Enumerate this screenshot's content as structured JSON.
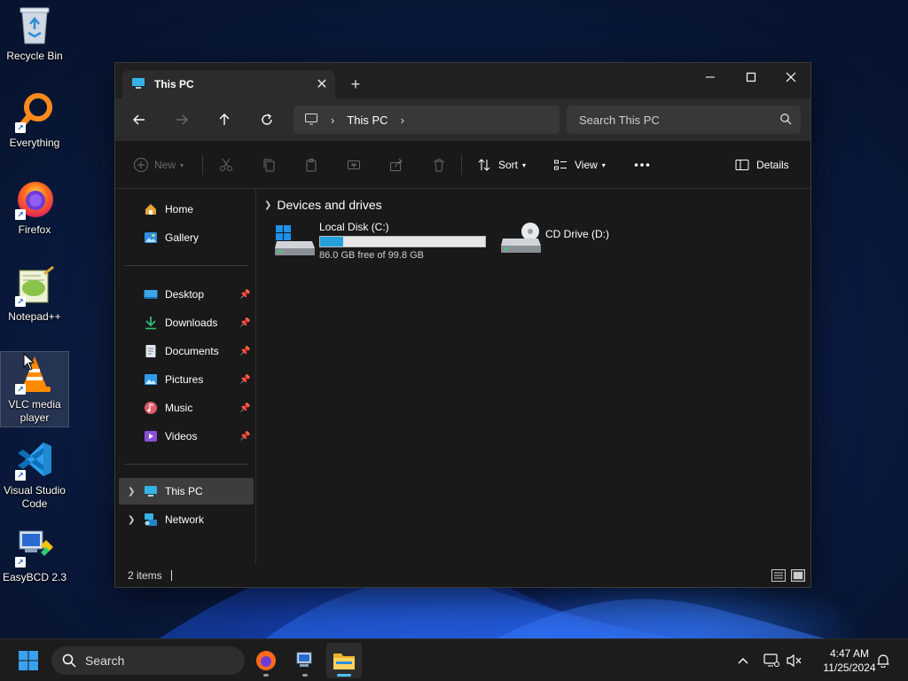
{
  "desktop": {
    "icons": [
      {
        "label": "Recycle Bin",
        "icon": "recycle-bin-icon"
      },
      {
        "label": "Everything",
        "icon": "everything-icon"
      },
      {
        "label": "Firefox",
        "icon": "firefox-icon"
      },
      {
        "label": "Notepad++",
        "icon": "notepad-plus-plus-icon"
      },
      {
        "label": "VLC media player",
        "icon": "vlc-icon"
      },
      {
        "label": "Visual Studio Code",
        "icon": "vscode-icon"
      },
      {
        "label": "EasyBCD 2.3",
        "icon": "easybcd-icon"
      }
    ]
  },
  "window": {
    "tab_title": "This PC",
    "address": {
      "crumb": "This PC"
    },
    "search": {
      "placeholder": "Search This PC"
    },
    "toolbar": {
      "new_label": "New",
      "sort_label": "Sort",
      "view_label": "View",
      "details_label": "Details"
    },
    "sidebar": {
      "items": [
        {
          "label": "Home",
          "icon": "home-icon",
          "pinned": false
        },
        {
          "label": "Gallery",
          "icon": "gallery-icon",
          "pinned": false
        },
        {
          "label": "Desktop",
          "icon": "desktop-folder-icon",
          "pinned": true
        },
        {
          "label": "Downloads",
          "icon": "downloads-icon",
          "pinned": true
        },
        {
          "label": "Documents",
          "icon": "documents-icon",
          "pinned": true
        },
        {
          "label": "Pictures",
          "icon": "pictures-icon",
          "pinned": true
        },
        {
          "label": "Music",
          "icon": "music-icon",
          "pinned": true
        },
        {
          "label": "Videos",
          "icon": "videos-icon",
          "pinned": true
        },
        {
          "label": "This PC",
          "icon": "this-pc-icon",
          "selected": true
        },
        {
          "label": "Network",
          "icon": "network-icon"
        }
      ]
    },
    "content": {
      "group_title": "Devices and drives",
      "drives": [
        {
          "name": "Local Disk (C:)",
          "free_text": "86.0 GB free of 99.8 GB",
          "used_fraction": 0.138
        },
        {
          "name": "CD Drive (D:)"
        }
      ]
    },
    "status": {
      "items_text": "2 items"
    }
  },
  "taskbar": {
    "search_placeholder": "Search",
    "time": "4:47 AM",
    "date": "11/25/2024"
  },
  "colors": {
    "accent": "#26a0da",
    "window_bg": "#191919",
    "taskbar_bg": "#1c1c1c"
  }
}
